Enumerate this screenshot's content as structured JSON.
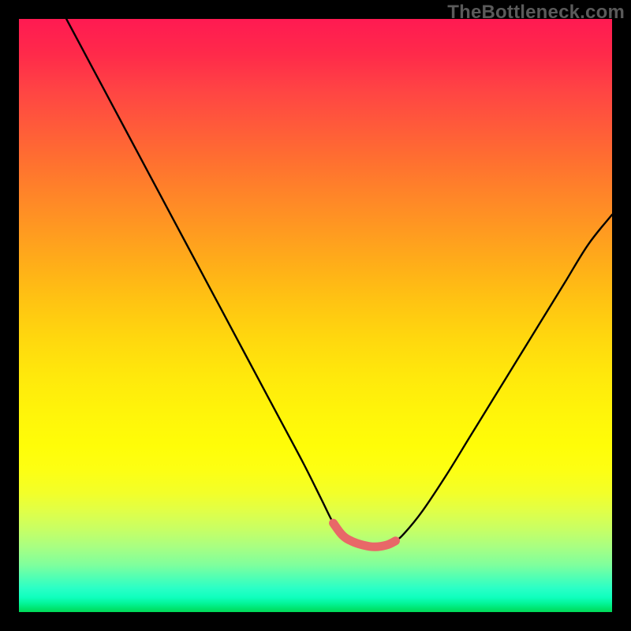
{
  "watermark": {
    "text": "TheBottleneck.com"
  },
  "chart_data": {
    "type": "line",
    "title": "",
    "xlabel": "",
    "ylabel": "",
    "xlim": [
      0,
      100
    ],
    "ylim": [
      0,
      100
    ],
    "series": [
      {
        "name": "bottleneck-curve",
        "x": [
          8,
          12,
          16,
          20,
          24,
          28,
          32,
          36,
          40,
          44,
          48,
          51,
          53,
          54.5,
          56,
          58,
          60,
          62,
          63.5,
          65,
          68,
          72,
          76,
          80,
          84,
          88,
          92,
          96,
          100
        ],
        "values": [
          100,
          92.5,
          85,
          77.5,
          70,
          62.5,
          55,
          47.5,
          40,
          32.5,
          25,
          19,
          15,
          13,
          12,
          11.3,
          11,
          11.3,
          12,
          13.3,
          17,
          23,
          29.5,
          36,
          42.5,
          49,
          55.5,
          62,
          67
        ]
      },
      {
        "name": "low-bottleneck-highlight",
        "x": [
          53,
          54.5,
          56,
          58,
          60,
          62,
          63.5
        ],
        "values": [
          15,
          13,
          12,
          11.3,
          11,
          11.3,
          12
        ]
      }
    ]
  }
}
